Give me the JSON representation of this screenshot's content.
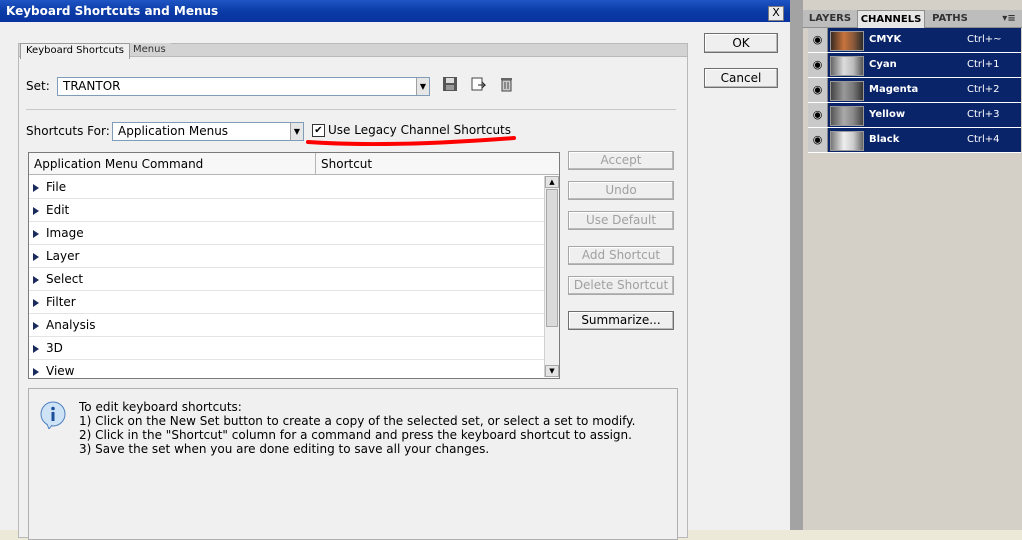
{
  "dialog": {
    "title": "Keyboard Shortcuts and Menus",
    "close_label": "X",
    "tabs": [
      "Keyboard Shortcuts",
      "Menus"
    ],
    "set_label": "Set:",
    "set_value": "TRANTOR",
    "shortcuts_for_label": "Shortcuts For:",
    "shortcuts_for_value": "Application Menus",
    "legacy_checkbox_label": "Use Legacy Channel Shortcuts",
    "legacy_checked": true,
    "ok_label": "OK",
    "cancel_label": "Cancel",
    "table": {
      "col1": "Application Menu Command",
      "col2": "Shortcut",
      "rows": [
        "File",
        "Edit",
        "Image",
        "Layer",
        "Select",
        "Filter",
        "Analysis",
        "3D",
        "View"
      ]
    },
    "buttons": {
      "accept": "Accept",
      "undo": "Undo",
      "use_default": "Use Default",
      "add_shortcut": "Add Shortcut",
      "delete_shortcut": "Delete Shortcut",
      "summarize": "Summarize..."
    },
    "info": {
      "icon": "info-icon",
      "lines": [
        "To edit keyboard shortcuts:",
        "1) Click on the New Set button to create a copy of the selected set, or select a set to modify.",
        "2) Click in the \"Shortcut\" column for a command and press the keyboard shortcut to assign.",
        "3) Save the set when you are done editing to save all your changes."
      ]
    }
  },
  "palette": {
    "tabs": [
      "LAYERS",
      "CHANNELS",
      "PATHS"
    ],
    "channels": [
      {
        "name": "CMYK",
        "shortcut": "Ctrl+~"
      },
      {
        "name": "Cyan",
        "shortcut": "Ctrl+1"
      },
      {
        "name": "Magenta",
        "shortcut": "Ctrl+2"
      },
      {
        "name": "Yellow",
        "shortcut": "Ctrl+3"
      },
      {
        "name": "Black",
        "shortcut": "Ctrl+4"
      }
    ]
  },
  "colors": {
    "title_bar": "#0a3aa6",
    "selection": "#0a246a",
    "annotation": "#ff0000"
  }
}
